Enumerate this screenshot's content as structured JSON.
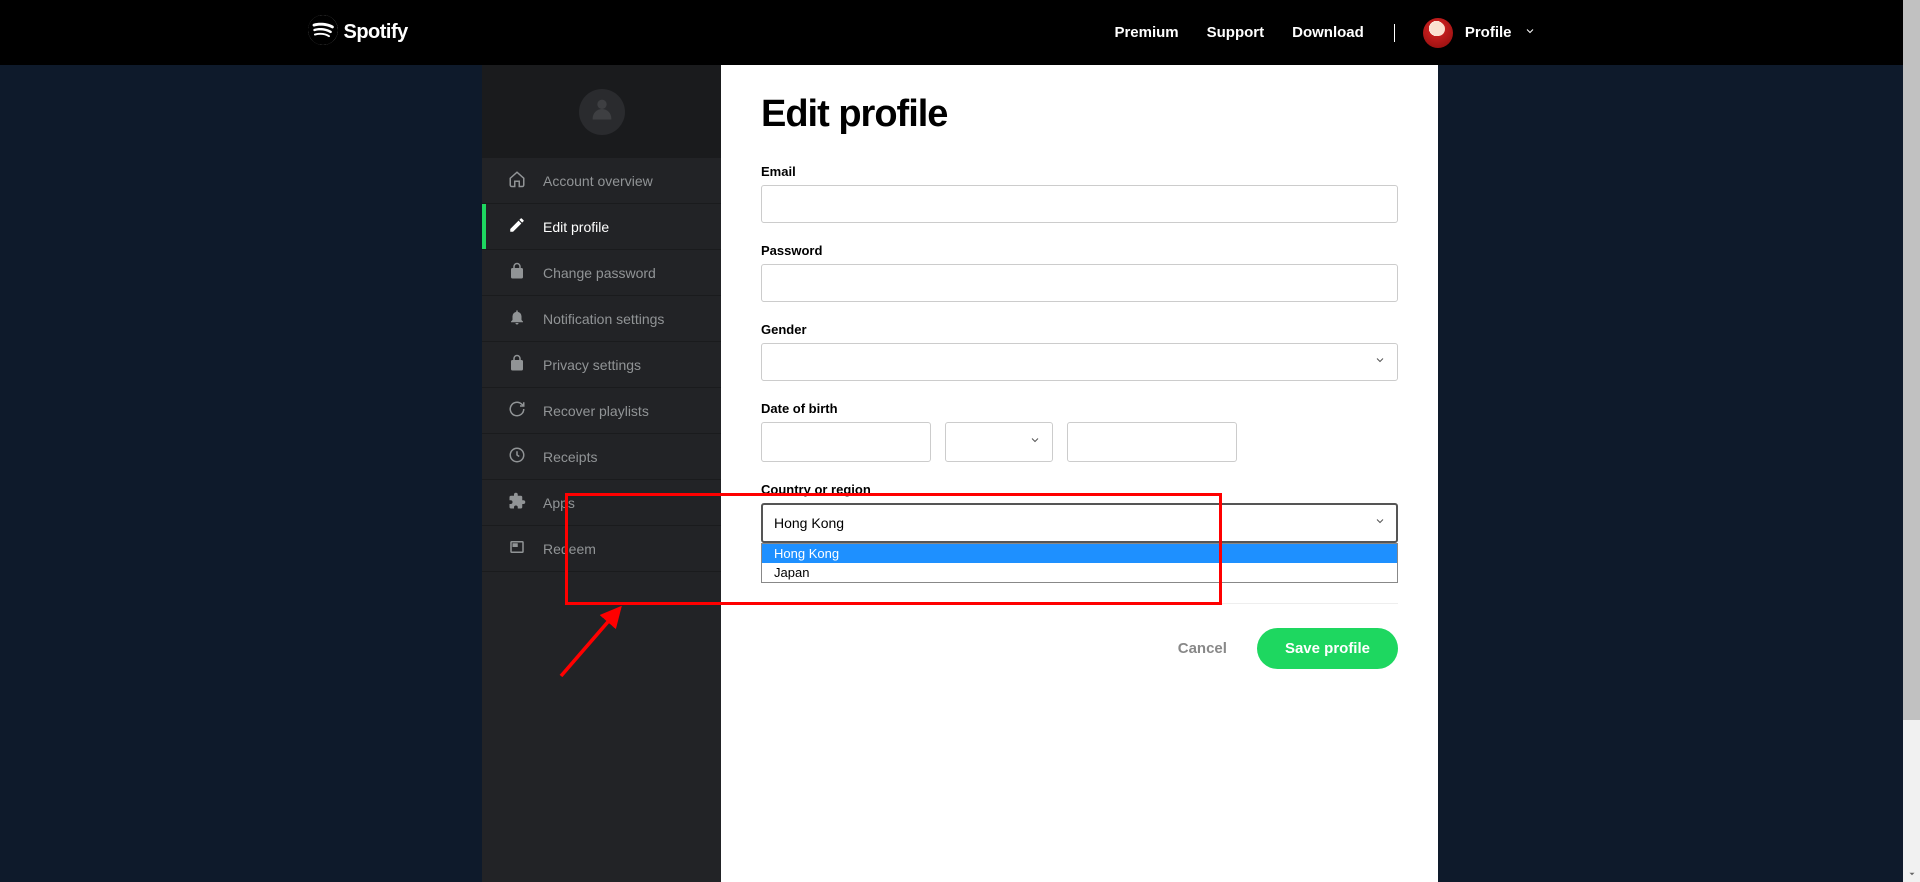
{
  "brand": {
    "name": "Spotify"
  },
  "nav": {
    "premium": "Premium",
    "support": "Support",
    "download": "Download",
    "profile_label": "Profile"
  },
  "sidebar": {
    "items": [
      {
        "label": "Account overview",
        "icon": "home-icon"
      },
      {
        "label": "Edit profile",
        "icon": "pencil-icon",
        "active": true
      },
      {
        "label": "Change password",
        "icon": "lock-icon"
      },
      {
        "label": "Notification settings",
        "icon": "bell-icon"
      },
      {
        "label": "Privacy settings",
        "icon": "lock-icon"
      },
      {
        "label": "Recover playlists",
        "icon": "refresh-icon"
      },
      {
        "label": "Receipts",
        "icon": "clock-icon"
      },
      {
        "label": "Apps",
        "icon": "puzzle-icon"
      },
      {
        "label": "Redeem",
        "icon": "card-icon"
      }
    ]
  },
  "page": {
    "title": "Edit profile"
  },
  "form": {
    "email": {
      "label": "Email",
      "value": ""
    },
    "password": {
      "label": "Password",
      "value": ""
    },
    "gender": {
      "label": "Gender",
      "value": ""
    },
    "dob": {
      "label": "Date of birth",
      "day": "",
      "month": "",
      "year": ""
    },
    "country": {
      "label": "Country or region",
      "value": "Hong Kong",
      "options": [
        "Hong Kong",
        "Japan"
      ],
      "highlighted_option": "Hong Kong"
    }
  },
  "buttons": {
    "cancel": "Cancel",
    "save": "Save profile"
  },
  "colors": {
    "accent": "#1ed760",
    "highlight": "#1e90ff",
    "annotation": "#ff0000"
  }
}
